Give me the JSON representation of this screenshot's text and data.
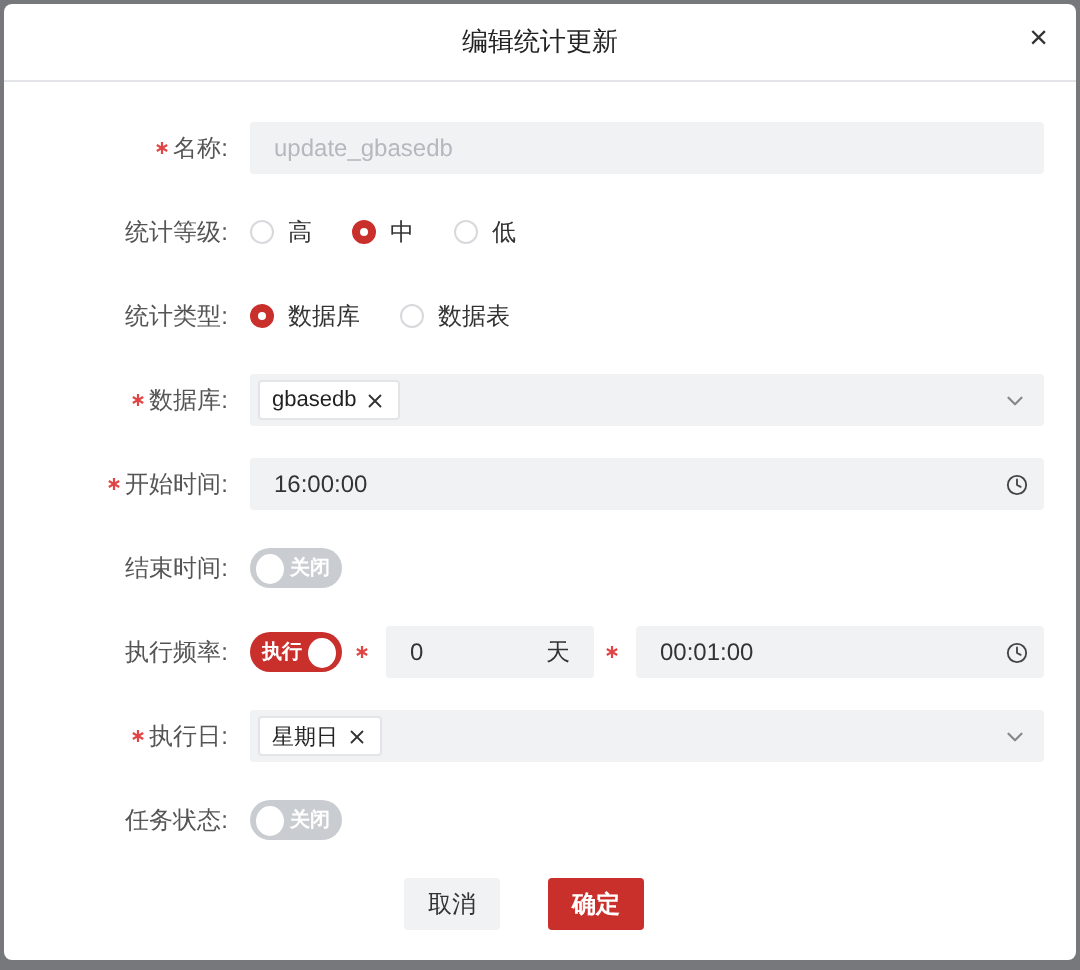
{
  "dialog": {
    "title": "编辑统计更新",
    "close": "×"
  },
  "fields": [
    {
      "kind": "text",
      "label": "名称:",
      "required": true,
      "value": "update_gbasedb",
      "disabled": true
    },
    {
      "kind": "radio",
      "label": "统计等级:",
      "required": false,
      "options": [
        {
          "label": "高",
          "selected": false
        },
        {
          "label": "中",
          "selected": true
        },
        {
          "label": "低",
          "selected": false
        }
      ]
    },
    {
      "kind": "radio",
      "label": "统计类型:",
      "required": false,
      "options": [
        {
          "label": "数据库",
          "selected": true
        },
        {
          "label": "数据表",
          "selected": false
        }
      ]
    },
    {
      "kind": "tags",
      "label": "数据库:",
      "required": true,
      "tags": [
        "gbasedb"
      ]
    },
    {
      "kind": "time",
      "label": "开始时间:",
      "required": true,
      "value": "16:00:00"
    },
    {
      "kind": "switch",
      "label": "结束时间:",
      "required": false,
      "on": false,
      "text": "关闭"
    },
    {
      "kind": "frequency",
      "label": "执行频率:",
      "required": false,
      "switch": {
        "on": true,
        "text": "执行"
      },
      "days": {
        "value": "0",
        "unit": "天",
        "required": true
      },
      "time": {
        "value": "00:01:00",
        "required": true
      }
    },
    {
      "kind": "tags",
      "label": "执行日:",
      "required": true,
      "tags": [
        "星期日"
      ]
    },
    {
      "kind": "switch",
      "label": "任务状态:",
      "required": false,
      "on": false,
      "text": "关闭"
    }
  ],
  "buttons": [
    {
      "label": "取消",
      "kind": "secondary"
    },
    {
      "label": "确定",
      "kind": "primary"
    }
  ]
}
